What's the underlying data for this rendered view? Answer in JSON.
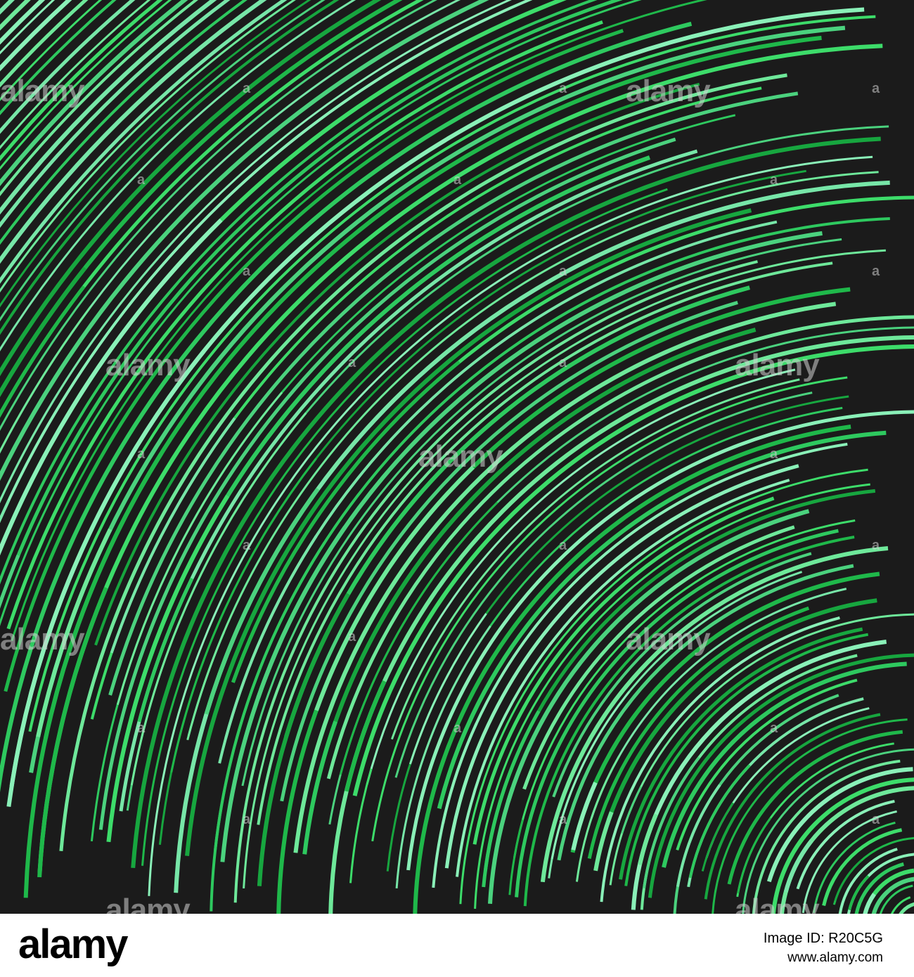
{
  "image": {
    "subject": "concentric green arcs on dark background",
    "background_color": "#1b1b1b",
    "arc_colors": [
      "#3ddc6a",
      "#6ee89a",
      "#1fb84a",
      "#8af0b8",
      "#4bd27e",
      "#2ec95f",
      "#77e6a8",
      "#17a63f"
    ]
  },
  "watermark": {
    "text": "alamy",
    "corner_mark": "a"
  },
  "footer": {
    "logo": "alamy",
    "image_id": "Image ID: R20C5G",
    "url": "www.alamy.com"
  }
}
